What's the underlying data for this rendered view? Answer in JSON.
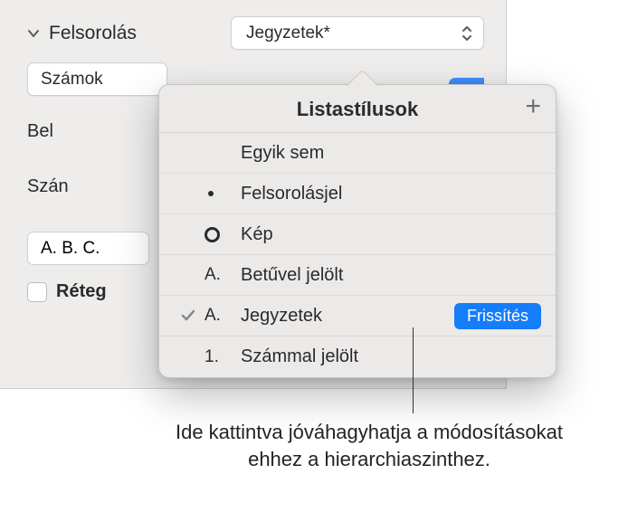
{
  "header": {
    "section_label": "Felsorolás",
    "dropdown_value": "Jegyzetek*"
  },
  "sub": {
    "numbers_label": "Számok",
    "bel_label": "Bel",
    "szan_label": "Szán",
    "letters_value": "A. B. C.",
    "layer_label": "Réteg"
  },
  "popover": {
    "title": "Listastílusok",
    "add_label": "+",
    "update_label": "Frissítés",
    "items": [
      {
        "icon": "",
        "label": "Egyik sem"
      },
      {
        "icon": "dot",
        "label": "Felsorolásjel"
      },
      {
        "icon": "ring",
        "label": "Kép"
      },
      {
        "icon": "A.",
        "label": "Betűvel jelölt"
      },
      {
        "icon": "A.",
        "label": "Jegyzetek",
        "checked": true,
        "update": true
      },
      {
        "icon": "1.",
        "label": "Számmal jelölt"
      }
    ]
  },
  "callout": {
    "text": "Ide kattintva jóváhagyhatja a módosításokat ehhez a hierarchiaszinthez."
  }
}
